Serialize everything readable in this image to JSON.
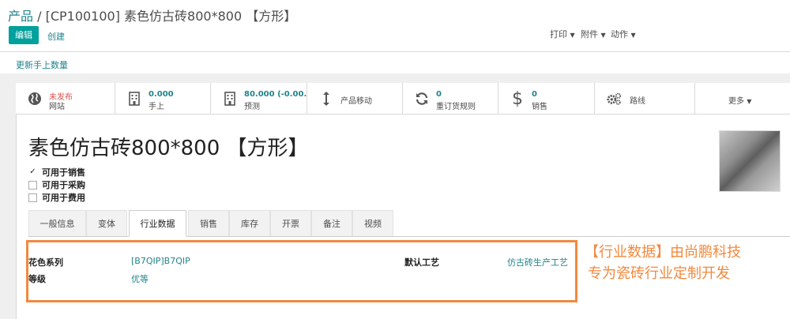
{
  "breadcrumb": {
    "parent": "产品",
    "separator": " / ",
    "current": "[CP100100] 素色仿古砖800*800 【方形】"
  },
  "control": {
    "edit_label": "编辑",
    "create_label": "创建"
  },
  "actions": {
    "print": "打印",
    "attachment": "附件",
    "action": "动作"
  },
  "update_qty_label": "更新手上数量",
  "smart_buttons": [
    {
      "icon": "globe-icon",
      "value": "未发布",
      "label": "网站",
      "value_color": "#d9534f"
    },
    {
      "icon": "building-icon",
      "value": "0.000",
      "label": "手上"
    },
    {
      "icon": "building-icon",
      "value": "80.000 (-0.00...+",
      "label": "预测"
    },
    {
      "icon": "arrows-vertical-icon",
      "label": "产品移动"
    },
    {
      "icon": "refresh-icon",
      "value": "0",
      "label": "重订货规则"
    },
    {
      "icon": "dollar-icon",
      "value": "0",
      "label": "销售"
    },
    {
      "icon": "cogs-icon",
      "label": "路线"
    },
    {
      "label": "更多"
    }
  ],
  "product": {
    "name": "素色仿古砖800*800 【方形】",
    "checkboxes": [
      {
        "label": "可用于销售",
        "checked": true
      },
      {
        "label": "可用于采购",
        "checked": false
      },
      {
        "label": "可用于费用",
        "checked": false
      }
    ]
  },
  "tabs": [
    "一般信息",
    "变体",
    "行业数据",
    "销售",
    "库存",
    "开票",
    "备注",
    "视频"
  ],
  "active_tab": "行业数据",
  "industry_fields": {
    "color_series_label": "花色系列",
    "color_series_value": "[B7QIP]B7QIP",
    "grade_label": "等级",
    "grade_value": "优等",
    "process_label": "默认工艺",
    "process_value": "仿古砖生产工艺"
  },
  "annotation": {
    "line1": "【行业数据】由尚鹏科技",
    "line2": "专为瓷砖行业定制开发"
  },
  "colors": {
    "primary": "#00a09d",
    "link": "#21848c",
    "highlight": "#f2893f"
  }
}
